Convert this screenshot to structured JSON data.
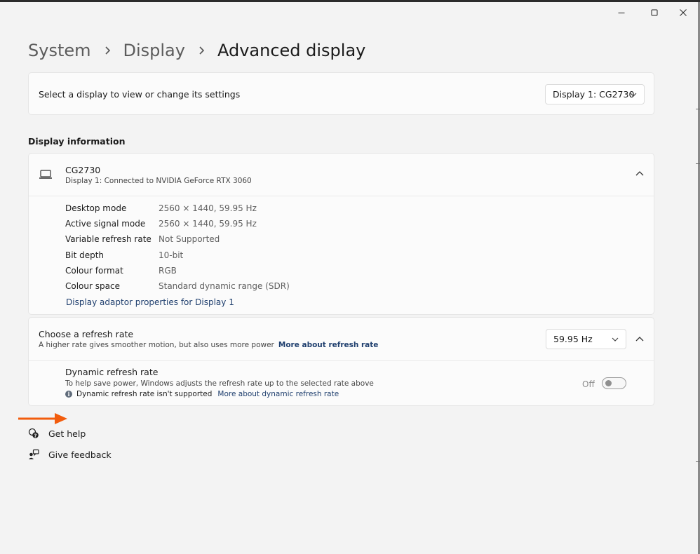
{
  "window": {
    "minimize_icon": "minimize-icon",
    "maximize_icon": "maximize-icon",
    "close_icon": "close-icon"
  },
  "breadcrumb": [
    "System",
    "Display",
    "Advanced display"
  ],
  "select_display": {
    "label": "Select a display to view or change its settings",
    "value": "Display 1: CG2730"
  },
  "display_info": {
    "section_title": "Display information",
    "name": "CG2730",
    "subtitle": "Display 1: Connected to NVIDIA GeForce RTX 3060",
    "rows": [
      {
        "label": "Desktop mode",
        "value": "2560 × 1440, 59.95 Hz"
      },
      {
        "label": "Active signal mode",
        "value": "2560 × 1440, 59.95 Hz"
      },
      {
        "label": "Variable refresh rate",
        "value": "Not Supported"
      },
      {
        "label": "Bit depth",
        "value": "10-bit"
      },
      {
        "label": "Colour format",
        "value": "RGB"
      },
      {
        "label": "Colour space",
        "value": "Standard dynamic range (SDR)"
      }
    ],
    "adapter_link": "Display adaptor properties for Display 1"
  },
  "refresh": {
    "title": "Choose a refresh rate",
    "subtitle": "A higher rate gives smoother motion, but also uses more power",
    "more_link": "More about refresh rate",
    "value": "59.95 Hz",
    "dynamic": {
      "title": "Dynamic refresh rate",
      "subtitle": "To help save power, Windows adjusts the refresh rate up to the selected rate above",
      "note": "Dynamic refresh rate isn't supported",
      "note_link": "More about dynamic refresh rate",
      "toggle_label": "Off",
      "toggle_on": false
    }
  },
  "help": {
    "get_help": "Get help",
    "give_feedback": "Give feedback"
  },
  "colors": {
    "background": "#f3f3f3",
    "card": "#fbfbfb",
    "link": "#1f3f6e",
    "annotation_arrow": "#f25c0d"
  }
}
